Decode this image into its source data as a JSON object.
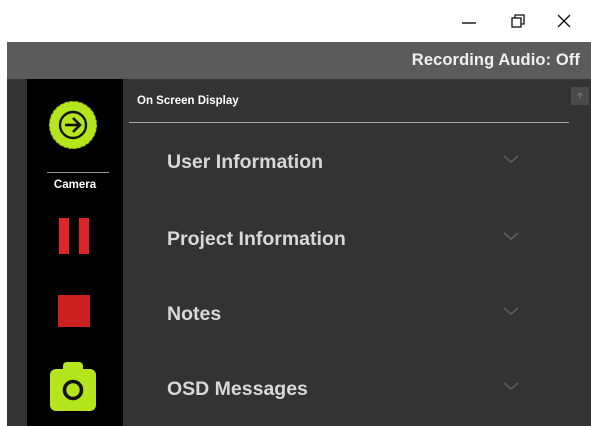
{
  "window": {
    "controls": {
      "minimize_icon": "minimize-icon",
      "restore_icon": "restore-icon",
      "close_icon": "close-icon"
    }
  },
  "status": {
    "recording_audio": "Recording Audio: Off"
  },
  "sidebar": {
    "go_icon": "arrow-right-circle-icon",
    "camera_label": "Camera",
    "pause_icon": "pause-icon",
    "stop_icon": "stop-icon",
    "snapshot_icon": "camera-icon"
  },
  "panel": {
    "title": "On Screen Display",
    "sections": [
      {
        "label": "User Information"
      },
      {
        "label": "Project Information"
      },
      {
        "label": "Notes"
      },
      {
        "label": "OSD Messages"
      }
    ]
  },
  "colors": {
    "accent_green": "#b5e61d",
    "record_red": "#e0252a",
    "panel_bg": "#333333",
    "statusbar_bg": "#5b5b5b",
    "sidebar_bg": "#000000"
  }
}
